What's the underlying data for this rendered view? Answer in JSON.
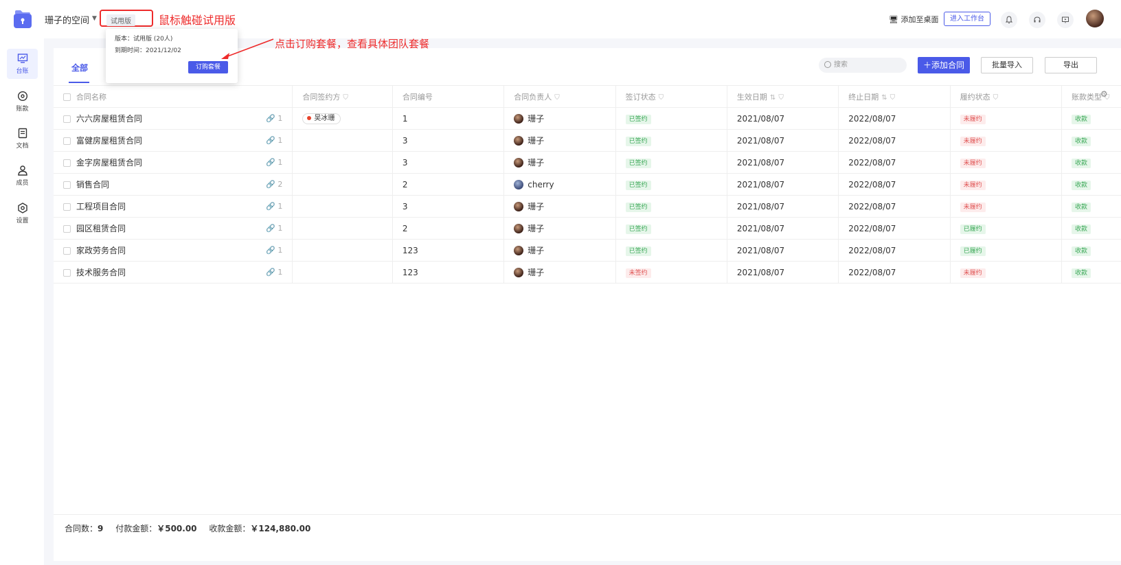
{
  "header": {
    "space_name": "珊子的空间",
    "trial_label": "试用版",
    "add_desktop": "添加至桌面",
    "enter_workspace": "进入工作台"
  },
  "annotations": {
    "hover_trial": "鼠标触碰试用版",
    "click_subscribe": "点击订购套餐，查看具体团队套餐"
  },
  "popover": {
    "version": "版本：试用版 (20人)",
    "expiry": "到期时间：2021/12/02",
    "subscribe_button": "订购套餐"
  },
  "sidebar": {
    "items": [
      {
        "label": "台账",
        "icon": "chart-icon"
      },
      {
        "label": "账款",
        "icon": "coin-icon"
      },
      {
        "label": "文档",
        "icon": "document-icon"
      },
      {
        "label": "成员",
        "icon": "person-icon"
      },
      {
        "label": "设置",
        "icon": "settings-icon"
      }
    ]
  },
  "main": {
    "tab_all": "全部",
    "search_placeholder": "搜索",
    "add_contract": "添加合同",
    "batch_import": "批量导入",
    "export": "导出"
  },
  "table": {
    "columns": [
      "合同名称",
      "合同签约方",
      "合同编号",
      "合同负责人",
      "签订状态",
      "生效日期",
      "终止日期",
      "履约状态",
      "账款类型"
    ],
    "rows": [
      {
        "name": "六六房屋租赁合同",
        "attach": "1",
        "party": "吴冰珊",
        "number": "1",
        "owner": "珊子",
        "sign": "已签约",
        "sign_color": "green",
        "start": "2021/08/07",
        "end": "2022/08/07",
        "perform": "未履约",
        "perform_color": "red",
        "type": "收款"
      },
      {
        "name": "富健房屋租赁合同",
        "attach": "1",
        "party": "",
        "number": "3",
        "owner": "珊子",
        "sign": "已签约",
        "sign_color": "green",
        "start": "2021/08/07",
        "end": "2022/08/07",
        "perform": "未履约",
        "perform_color": "red",
        "type": "收款"
      },
      {
        "name": "金字房屋租赁合同",
        "attach": "1",
        "party": "",
        "number": "3",
        "owner": "珊子",
        "sign": "已签约",
        "sign_color": "green",
        "start": "2021/08/07",
        "end": "2022/08/07",
        "perform": "未履约",
        "perform_color": "red",
        "type": "收款"
      },
      {
        "name": "销售合同",
        "attach": "2",
        "party": "",
        "number": "2",
        "owner": "cherry",
        "sign": "已签约",
        "sign_color": "green",
        "start": "2021/08/07",
        "end": "2022/08/07",
        "perform": "未履约",
        "perform_color": "red",
        "type": "收款"
      },
      {
        "name": "工程项目合同",
        "attach": "1",
        "party": "",
        "number": "3",
        "owner": "珊子",
        "sign": "已签约",
        "sign_color": "green",
        "start": "2021/08/07",
        "end": "2022/08/07",
        "perform": "未履约",
        "perform_color": "red",
        "type": "收款"
      },
      {
        "name": "园区租赁合同",
        "attach": "1",
        "party": "",
        "number": "2",
        "owner": "珊子",
        "sign": "已签约",
        "sign_color": "green",
        "start": "2021/08/07",
        "end": "2022/08/07",
        "perform": "已履约",
        "perform_color": "green",
        "type": "收款"
      },
      {
        "name": "家政劳务合同",
        "attach": "1",
        "party": "",
        "number": "123",
        "owner": "珊子",
        "sign": "已签约",
        "sign_color": "green",
        "start": "2021/08/07",
        "end": "2022/08/07",
        "perform": "已履约",
        "perform_color": "green",
        "type": "收款"
      },
      {
        "name": "技术服务合同",
        "attach": "1",
        "party": "",
        "number": "123",
        "owner": "珊子",
        "sign": "未签约",
        "sign_color": "red",
        "start": "2021/08/07",
        "end": "2022/08/07",
        "perform": "未履约",
        "perform_color": "red",
        "type": "收款"
      }
    ]
  },
  "footer": {
    "count_label": "合同数：",
    "count_value": "9",
    "pay_label": "付款金额：",
    "pay_value": "￥500.00",
    "receive_label": "收款金额：",
    "receive_value": "￥124,880.00"
  },
  "colors": {
    "accent": "#4a5ae8",
    "annotation": "#ee2b2b"
  }
}
